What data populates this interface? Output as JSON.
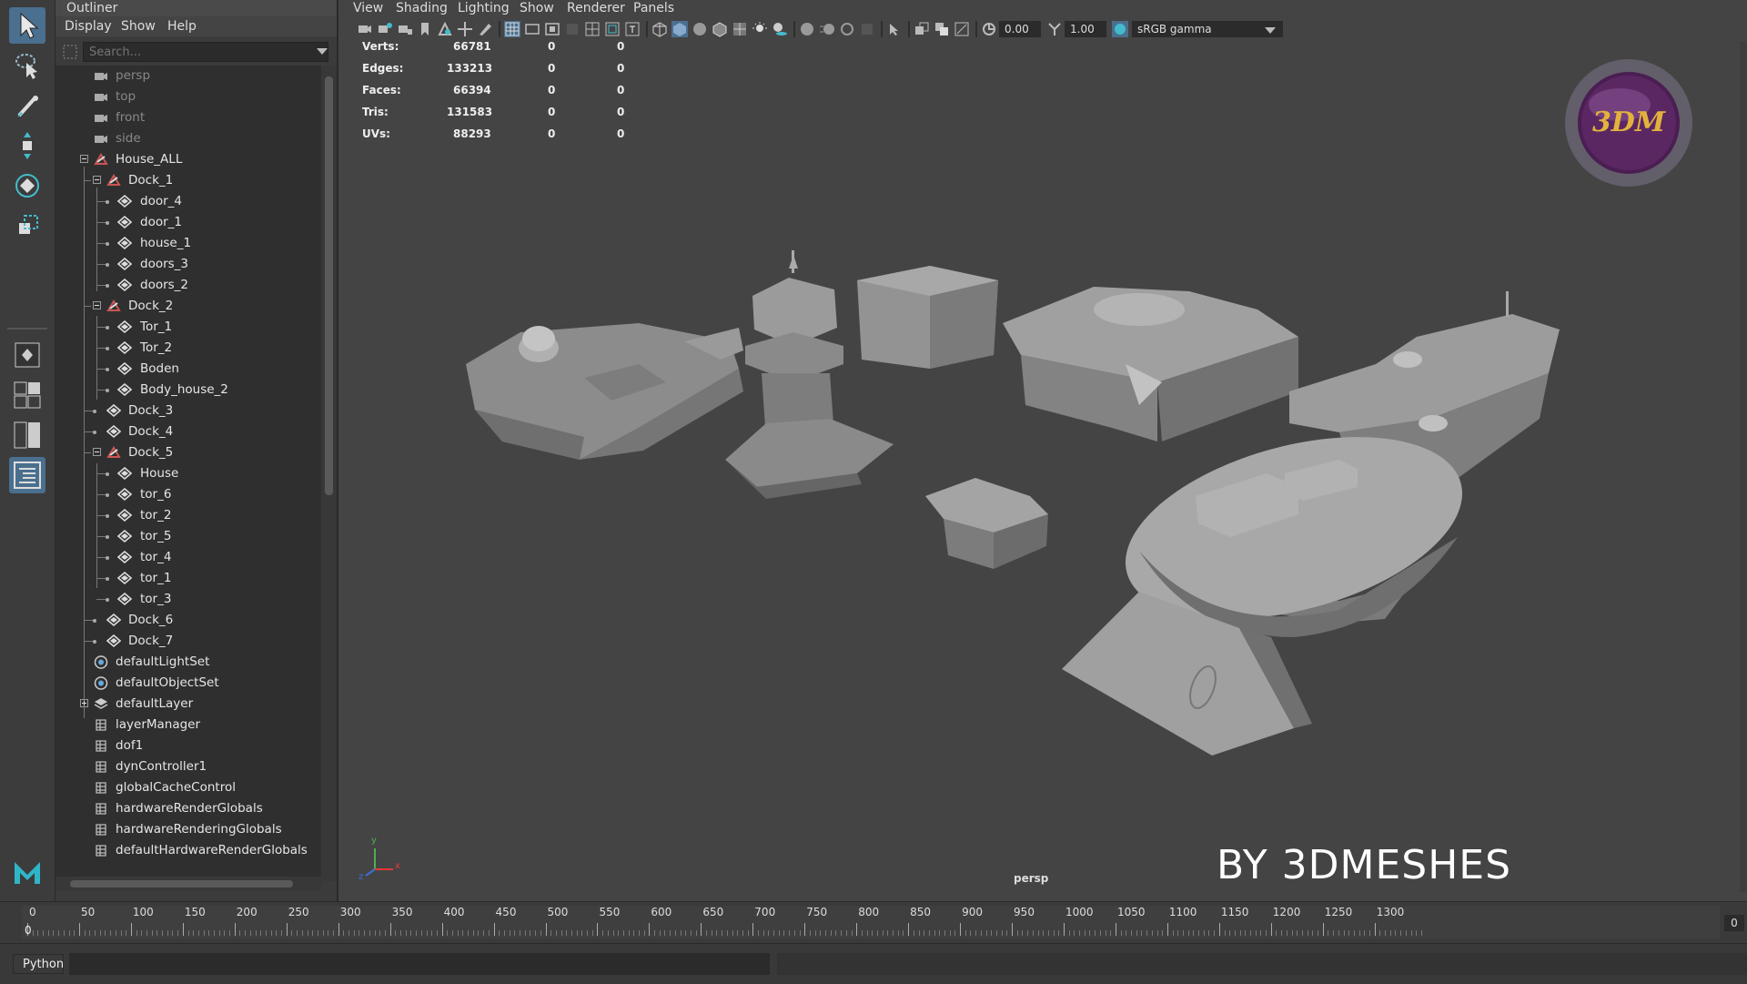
{
  "outliner": {
    "title": "Outliner",
    "menu": [
      "Display",
      "Show",
      "Help"
    ],
    "search_placeholder": "Search...",
    "items": [
      {
        "label": "persp"
      },
      {
        "label": "top"
      },
      {
        "label": "front"
      },
      {
        "label": "side"
      },
      {
        "label": "House_ALL"
      },
      {
        "label": "Dock_1"
      },
      {
        "label": "door_4"
      },
      {
        "label": "door_1"
      },
      {
        "label": "house_1"
      },
      {
        "label": "doors_3"
      },
      {
        "label": "doors_2"
      },
      {
        "label": "Dock_2"
      },
      {
        "label": "Tor_1"
      },
      {
        "label": "Tor_2"
      },
      {
        "label": "Boden"
      },
      {
        "label": "Body_house_2"
      },
      {
        "label": "Dock_3"
      },
      {
        "label": "Dock_4"
      },
      {
        "label": "Dock_5"
      },
      {
        "label": "House"
      },
      {
        "label": "tor_6"
      },
      {
        "label": "tor_2"
      },
      {
        "label": "tor_5"
      },
      {
        "label": "tor_4"
      },
      {
        "label": "tor_1"
      },
      {
        "label": "tor_3"
      },
      {
        "label": "Dock_6"
      },
      {
        "label": "Dock_7"
      },
      {
        "label": "defaultLightSet"
      },
      {
        "label": "defaultObjectSet"
      },
      {
        "label": "defaultLayer"
      },
      {
        "label": "layerManager"
      },
      {
        "label": "dof1"
      },
      {
        "label": "dynController1"
      },
      {
        "label": "globalCacheControl"
      },
      {
        "label": "hardwareRenderGlobals"
      },
      {
        "label": "hardwareRenderingGlobals"
      },
      {
        "label": "defaultHardwareRenderGlobals"
      }
    ]
  },
  "viewport": {
    "menu": [
      "View",
      "Shading",
      "Lighting",
      "Show",
      "Renderer",
      "Panels"
    ],
    "exposure": "0.00",
    "gamma": "1.00",
    "color_space": "sRGB gamma",
    "camera_label": "persp",
    "watermark": "BY 3DMESHES",
    "logo_text": "3DM",
    "hud": [
      {
        "label": "Verts:",
        "total": "66781",
        "sel": "0",
        "comp": "0"
      },
      {
        "label": "Edges:",
        "total": "133213",
        "sel": "0",
        "comp": "0"
      },
      {
        "label": "Faces:",
        "total": "66394",
        "sel": "0",
        "comp": "0"
      },
      {
        "label": "Tris:",
        "total": "131583",
        "sel": "0",
        "comp": "0"
      },
      {
        "label": "UVs:",
        "total": "88293",
        "sel": "0",
        "comp": "0"
      }
    ],
    "axis": {
      "y": "y",
      "x": "x",
      "z": "z"
    }
  },
  "timeline": {
    "ticks": [
      "0",
      "50",
      "100",
      "150",
      "200",
      "250",
      "300",
      "350",
      "400",
      "450",
      "500",
      "550",
      "600",
      "650",
      "700",
      "750",
      "800",
      "850",
      "900",
      "950",
      "1000",
      "1050",
      "1100",
      "1150",
      "1200",
      "1250",
      "1300"
    ],
    "current_frame": "0",
    "end_field": "0"
  },
  "command_line": {
    "language": "Python"
  },
  "colors": {
    "accent": "#4a6f8f",
    "maya_logo": "#2fb5c8"
  }
}
